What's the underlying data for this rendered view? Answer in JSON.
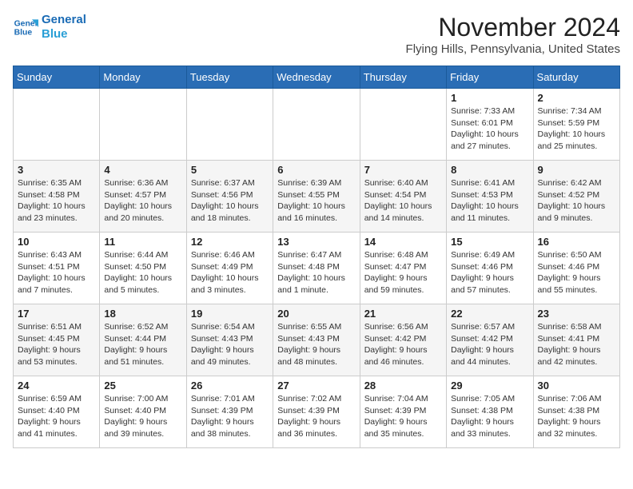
{
  "header": {
    "logo_line1": "General",
    "logo_line2": "Blue",
    "month_year": "November 2024",
    "location": "Flying Hills, Pennsylvania, United States"
  },
  "weekdays": [
    "Sunday",
    "Monday",
    "Tuesday",
    "Wednesday",
    "Thursday",
    "Friday",
    "Saturday"
  ],
  "weeks": [
    [
      {
        "day": "",
        "info": ""
      },
      {
        "day": "",
        "info": ""
      },
      {
        "day": "",
        "info": ""
      },
      {
        "day": "",
        "info": ""
      },
      {
        "day": "",
        "info": ""
      },
      {
        "day": "1",
        "info": "Sunrise: 7:33 AM\nSunset: 6:01 PM\nDaylight: 10 hours and 27 minutes."
      },
      {
        "day": "2",
        "info": "Sunrise: 7:34 AM\nSunset: 5:59 PM\nDaylight: 10 hours and 25 minutes."
      }
    ],
    [
      {
        "day": "3",
        "info": "Sunrise: 6:35 AM\nSunset: 4:58 PM\nDaylight: 10 hours and 23 minutes."
      },
      {
        "day": "4",
        "info": "Sunrise: 6:36 AM\nSunset: 4:57 PM\nDaylight: 10 hours and 20 minutes."
      },
      {
        "day": "5",
        "info": "Sunrise: 6:37 AM\nSunset: 4:56 PM\nDaylight: 10 hours and 18 minutes."
      },
      {
        "day": "6",
        "info": "Sunrise: 6:39 AM\nSunset: 4:55 PM\nDaylight: 10 hours and 16 minutes."
      },
      {
        "day": "7",
        "info": "Sunrise: 6:40 AM\nSunset: 4:54 PM\nDaylight: 10 hours and 14 minutes."
      },
      {
        "day": "8",
        "info": "Sunrise: 6:41 AM\nSunset: 4:53 PM\nDaylight: 10 hours and 11 minutes."
      },
      {
        "day": "9",
        "info": "Sunrise: 6:42 AM\nSunset: 4:52 PM\nDaylight: 10 hours and 9 minutes."
      }
    ],
    [
      {
        "day": "10",
        "info": "Sunrise: 6:43 AM\nSunset: 4:51 PM\nDaylight: 10 hours and 7 minutes."
      },
      {
        "day": "11",
        "info": "Sunrise: 6:44 AM\nSunset: 4:50 PM\nDaylight: 10 hours and 5 minutes."
      },
      {
        "day": "12",
        "info": "Sunrise: 6:46 AM\nSunset: 4:49 PM\nDaylight: 10 hours and 3 minutes."
      },
      {
        "day": "13",
        "info": "Sunrise: 6:47 AM\nSunset: 4:48 PM\nDaylight: 10 hours and 1 minute."
      },
      {
        "day": "14",
        "info": "Sunrise: 6:48 AM\nSunset: 4:47 PM\nDaylight: 9 hours and 59 minutes."
      },
      {
        "day": "15",
        "info": "Sunrise: 6:49 AM\nSunset: 4:46 PM\nDaylight: 9 hours and 57 minutes."
      },
      {
        "day": "16",
        "info": "Sunrise: 6:50 AM\nSunset: 4:46 PM\nDaylight: 9 hours and 55 minutes."
      }
    ],
    [
      {
        "day": "17",
        "info": "Sunrise: 6:51 AM\nSunset: 4:45 PM\nDaylight: 9 hours and 53 minutes."
      },
      {
        "day": "18",
        "info": "Sunrise: 6:52 AM\nSunset: 4:44 PM\nDaylight: 9 hours and 51 minutes."
      },
      {
        "day": "19",
        "info": "Sunrise: 6:54 AM\nSunset: 4:43 PM\nDaylight: 9 hours and 49 minutes."
      },
      {
        "day": "20",
        "info": "Sunrise: 6:55 AM\nSunset: 4:43 PM\nDaylight: 9 hours and 48 minutes."
      },
      {
        "day": "21",
        "info": "Sunrise: 6:56 AM\nSunset: 4:42 PM\nDaylight: 9 hours and 46 minutes."
      },
      {
        "day": "22",
        "info": "Sunrise: 6:57 AM\nSunset: 4:42 PM\nDaylight: 9 hours and 44 minutes."
      },
      {
        "day": "23",
        "info": "Sunrise: 6:58 AM\nSunset: 4:41 PM\nDaylight: 9 hours and 42 minutes."
      }
    ],
    [
      {
        "day": "24",
        "info": "Sunrise: 6:59 AM\nSunset: 4:40 PM\nDaylight: 9 hours and 41 minutes."
      },
      {
        "day": "25",
        "info": "Sunrise: 7:00 AM\nSunset: 4:40 PM\nDaylight: 9 hours and 39 minutes."
      },
      {
        "day": "26",
        "info": "Sunrise: 7:01 AM\nSunset: 4:39 PM\nDaylight: 9 hours and 38 minutes."
      },
      {
        "day": "27",
        "info": "Sunrise: 7:02 AM\nSunset: 4:39 PM\nDaylight: 9 hours and 36 minutes."
      },
      {
        "day": "28",
        "info": "Sunrise: 7:04 AM\nSunset: 4:39 PM\nDaylight: 9 hours and 35 minutes."
      },
      {
        "day": "29",
        "info": "Sunrise: 7:05 AM\nSunset: 4:38 PM\nDaylight: 9 hours and 33 minutes."
      },
      {
        "day": "30",
        "info": "Sunrise: 7:06 AM\nSunset: 4:38 PM\nDaylight: 9 hours and 32 minutes."
      }
    ]
  ]
}
